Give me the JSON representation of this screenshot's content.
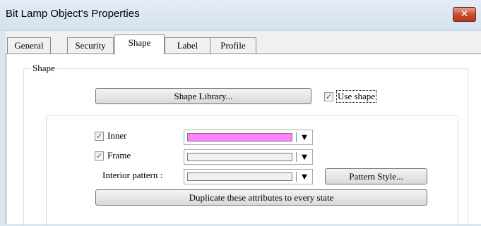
{
  "window": {
    "title": "Bit Lamp Object's Properties",
    "close_glyph": "✕"
  },
  "tabs": [
    {
      "label": "General",
      "active": false
    },
    {
      "label": "Security",
      "active": false
    },
    {
      "label": "Shape",
      "active": true
    },
    {
      "label": "Label",
      "active": false
    },
    {
      "label": "Profile",
      "active": false
    }
  ],
  "shape_group": {
    "label": "Shape",
    "shape_library_button": "Shape Library...",
    "use_shape": {
      "label": "Use shape",
      "checked": true
    }
  },
  "attributes": {
    "inner": {
      "label": "Inner",
      "checked": true,
      "color": "#ff80ff"
    },
    "frame": {
      "label": "Frame",
      "checked": true,
      "color": "#f0f0f0"
    },
    "interior_pattern": {
      "label": "Interior pattern :",
      "color": "#f0f0f0"
    },
    "pattern_style_button": "Pattern Style...",
    "duplicate_button": "Duplicate these attributes to every state"
  },
  "icons": {
    "check": "✓",
    "dropdown_arrow": "▼"
  },
  "colors": {
    "window_chrome": "#dce6f1",
    "inner_color": "#ff80ff"
  }
}
